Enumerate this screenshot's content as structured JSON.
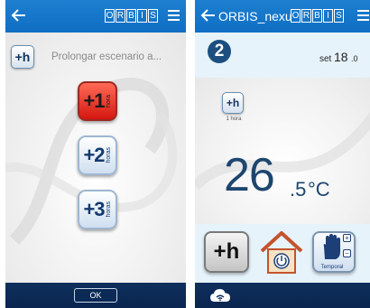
{
  "left_screen": {
    "brand_letters": [
      "O",
      "R",
      "B",
      "I",
      "S"
    ],
    "prolong_icon_label": "+h",
    "prolong_text": "Prolongar escenario a...",
    "options": [
      {
        "number": "+1",
        "unit": "hora",
        "selected": true
      },
      {
        "number": "+2",
        "unit": "horas",
        "selected": false
      },
      {
        "number": "+3",
        "unit": "horas",
        "selected": false
      }
    ],
    "ok_label": "OK"
  },
  "right_screen": {
    "title": "ORBIS_nexu",
    "brand_letters": [
      "O",
      "R",
      "B",
      "I",
      "S"
    ],
    "zone_number": "2",
    "set_label": "set",
    "set_value_int": "18",
    "set_value_dec": ".0",
    "extension_icon_label": "+h",
    "extension_caption": "1 hora",
    "temperature_int": "26",
    "temperature_dec": ".5",
    "temperature_unit": "°C",
    "extend_button_label": "+h",
    "temporal_label": "Temporal",
    "plus_label": "+",
    "minus_label": "−"
  },
  "colors": {
    "topbar": "#1479cb",
    "bottombar": "#0c2b58",
    "selected_option": "#e0291e",
    "temperature_text": "#1d466f",
    "band_light": "#e6f3fb"
  },
  "icons": [
    "back-arrow-icon",
    "menu-icon",
    "zone-number-icon",
    "house-power-icon",
    "hand-icon",
    "cloud-wifi-icon"
  ]
}
